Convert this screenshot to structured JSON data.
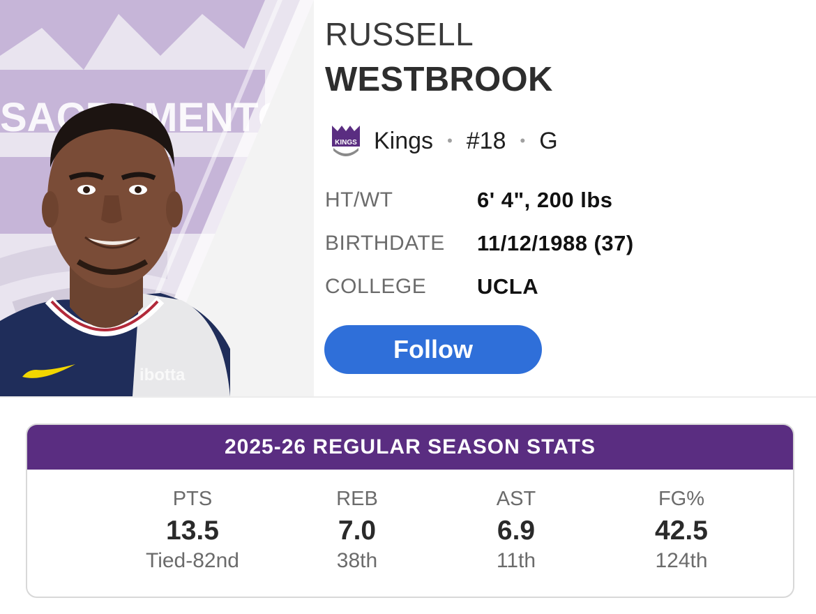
{
  "player": {
    "first_name": "RUSSELL",
    "last_name": "WESTBROOK",
    "team": "Kings",
    "number": "#18",
    "position": "G",
    "team_logo_icon": "kings-logo-icon",
    "dot_separator": "•"
  },
  "bio": [
    {
      "label": "HT/WT",
      "value": "6' 4\", 200 lbs"
    },
    {
      "label": "BIRTHDATE",
      "value": "11/12/1988 (37)"
    },
    {
      "label": "COLLEGE",
      "value": "UCLA"
    }
  ],
  "follow_label": "Follow",
  "stats": {
    "title": "2025-26 REGULAR SEASON STATS",
    "items": [
      {
        "label": "PTS",
        "value": "13.5",
        "rank": "Tied-82nd"
      },
      {
        "label": "REB",
        "value": "7.0",
        "rank": "38th"
      },
      {
        "label": "AST",
        "value": "6.9",
        "rank": "11th"
      },
      {
        "label": "FG%",
        "value": "42.5",
        "rank": "124th"
      }
    ]
  },
  "colors": {
    "team_purple": "#5a2d81",
    "follow_blue": "#2f6fd9",
    "background_logo_lavender": "#c6b5d8",
    "jersey_navy": "#1f2d5a"
  }
}
